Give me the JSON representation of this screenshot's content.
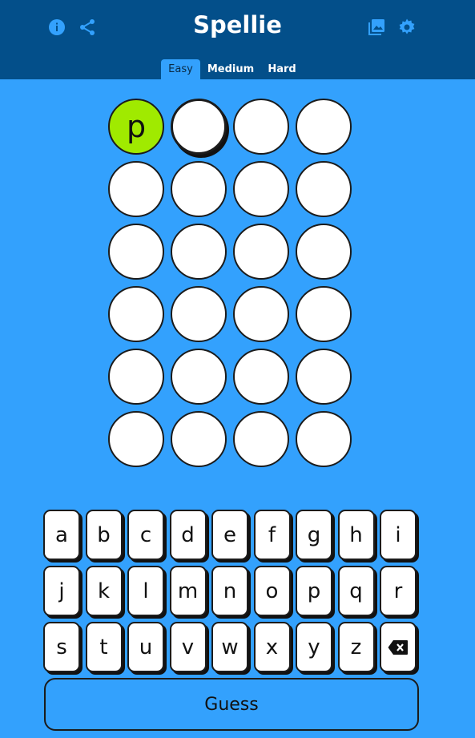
{
  "header": {
    "title": "Spellie",
    "left_icons": [
      "info-icon",
      "share-icon"
    ],
    "right_icons": [
      "gallery-icon",
      "settings-icon"
    ],
    "background": "#034f8a"
  },
  "tabs": [
    {
      "label": "Easy",
      "active": true
    },
    {
      "label": "Medium",
      "active": false
    },
    {
      "label": "Hard",
      "active": false
    }
  ],
  "board": {
    "rows": [
      [
        "p",
        "",
        "",
        ""
      ],
      [
        "",
        "",
        "",
        ""
      ],
      [
        "",
        "",
        "",
        ""
      ],
      [
        "",
        "",
        "",
        ""
      ],
      [
        "",
        "",
        "",
        ""
      ],
      [
        "",
        "",
        "",
        ""
      ]
    ],
    "filled_color": "#a0ea00"
  },
  "keyboard": {
    "rows": [
      [
        "a",
        "b",
        "c",
        "d",
        "e",
        "f",
        "g",
        "h",
        "i"
      ],
      [
        "j",
        "k",
        "l",
        "m",
        "n",
        "o",
        "p",
        "q",
        "r"
      ],
      [
        "s",
        "t",
        "u",
        "v",
        "w",
        "x",
        "y",
        "z",
        "backspace"
      ]
    ],
    "guess_label": "Guess"
  },
  "colors": {
    "background": "#33a1fd",
    "accent": "#a0ea00"
  }
}
